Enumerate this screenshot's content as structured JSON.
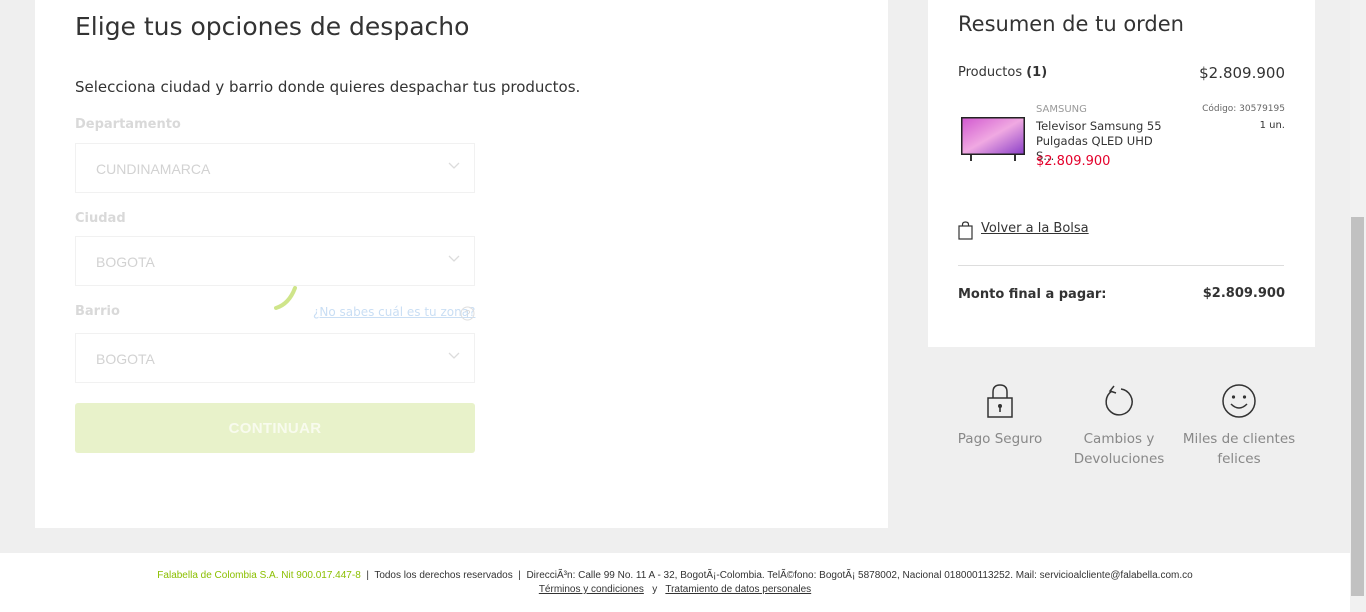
{
  "shipping": {
    "title": "Elige tus opciones de despacho",
    "subtitle": "Selecciona ciudad y barrio donde quieres despachar tus productos.",
    "department": {
      "label": "Departamento",
      "value": "CUNDINAMARCA"
    },
    "city": {
      "label": "Ciudad",
      "value": "BOGOTA"
    },
    "neighborhood": {
      "label": "Barrio",
      "value": "BOGOTA"
    },
    "help_link": "¿No sabes cuál es tu zona?",
    "continue_label": "CONTINUAR"
  },
  "summary": {
    "title": "Resumen de tu orden",
    "products_label": "Productos",
    "products_count": "(1)",
    "products_total": "$2.809.900",
    "item": {
      "brand": "SAMSUNG",
      "name": "Televisor Samsung 55 Pulgadas QLED UHD S...",
      "price": "$2.809.900",
      "code": "Código: 30579195",
      "units": "1 un."
    },
    "back_link": "Volver a la Bolsa",
    "final_label": "Monto final a pagar:",
    "final_value": "$2.809.900"
  },
  "benefits": [
    {
      "label": "Pago Seguro",
      "icon": "lock-icon"
    },
    {
      "label": "Cambios y Devoluciones",
      "icon": "return-arrow-icon"
    },
    {
      "label": "Miles de clientes felices",
      "icon": "smiley-icon"
    }
  ],
  "footer": {
    "company": "Falabella de Colombia S.A. Nit 900.017.447-8",
    "rights": "Todos los derechos reservados",
    "address": "DirecciÃ³n: Calle 99 No. 11 A - 32, BogotÃ¡-Colombia. TelÃ©fono: BogotÃ¡ 5878002, Nacional 018000113252. Mail: servicioalcliente@falabella.com.co",
    "terms": "Términos y condiciones",
    "and": "y",
    "privacy": "Tratamiento de datos personales"
  },
  "colors": {
    "accent_green": "#aad500",
    "price_red": "#e4002b",
    "background": "#efefef"
  }
}
